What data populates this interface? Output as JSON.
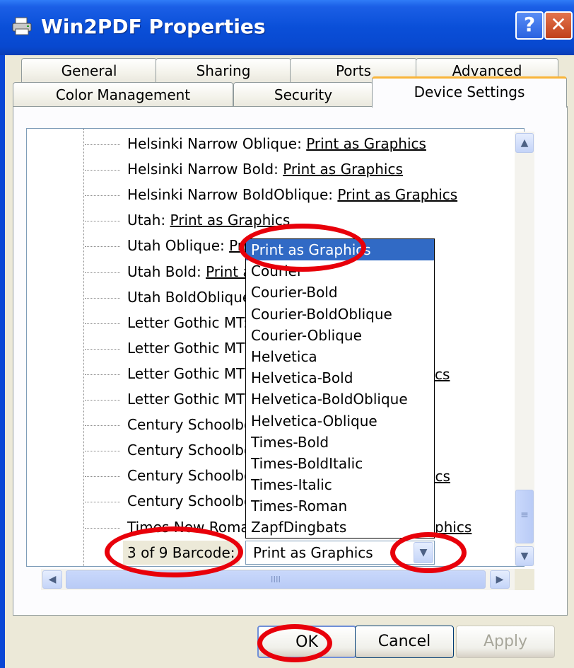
{
  "window": {
    "title": "Win2PDF Properties",
    "help_label": "?",
    "close_label": "✕"
  },
  "tabs_back": [
    "General",
    "Sharing",
    "Ports",
    "Advanced"
  ],
  "tabs_front": [
    "Color Management",
    "Security",
    "Device Settings"
  ],
  "tree_rows": [
    {
      "name": "Helsinki Narrow Oblique: ",
      "value": "Print as Graphics"
    },
    {
      "name": "Helsinki Narrow Bold: ",
      "value": "Print as Graphics"
    },
    {
      "name": "Helsinki Narrow BoldOblique: ",
      "value": "Print as Graphics"
    },
    {
      "name": "Utah: ",
      "value": "Print as Graphics"
    },
    {
      "name": "Utah Oblique: ",
      "value": "Prir"
    },
    {
      "name": "Utah Bold: ",
      "value": "Print a"
    },
    {
      "name": "Utah BoldOblique:",
      "value": ""
    },
    {
      "name": "Letter Gothic MT:",
      "value": ""
    },
    {
      "name": "Letter Gothic MT B",
      "value": ""
    },
    {
      "name": "Letter Gothic MT B",
      "value": ""
    },
    {
      "name": "Letter Gothic MT O",
      "value": ""
    },
    {
      "name": "Century Schoolbo",
      "value": ""
    },
    {
      "name": "Century Schoolbo",
      "value": ""
    },
    {
      "name": "Century Schoolbo",
      "value": ""
    },
    {
      "name": "Century Schoolbo",
      "value": ""
    },
    {
      "name": "Times New Roman",
      "value": ""
    }
  ],
  "right_fragments": [
    "cs",
    "ics",
    "phics"
  ],
  "dropdown_options": [
    "Print as Graphics",
    "Courier",
    "Courier-Bold",
    "Courier-BoldOblique",
    "Courier-Oblique",
    "Helvetica",
    "Helvetica-Bold",
    "Helvetica-BoldOblique",
    "Helvetica-Oblique",
    "Times-Bold",
    "Times-BoldItalic",
    "Times-Italic",
    "Times-Roman",
    "ZapfDingbats"
  ],
  "barcode": {
    "label": "3 of 9 Barcode:",
    "value": "Print as Graphics"
  },
  "scroll_glyphs": {
    "up": "▲",
    "down": "▼",
    "left": "◀",
    "right": "▶",
    "grip": "IIII",
    "vgrip": "≡"
  },
  "buttons": {
    "ok": "OK",
    "cancel": "Cancel",
    "apply": "Apply"
  },
  "colors": {
    "title_bar": "#0a4fd8",
    "selection": "#316ac5",
    "annotation_ring": "#e8000a",
    "active_tab_accent": "#f9b53a"
  },
  "icons": [
    "printer-icon",
    "help-icon",
    "close-icon",
    "chevron-down-icon",
    "scroll-up-icon",
    "scroll-down-icon",
    "scroll-left-icon",
    "scroll-right-icon"
  ]
}
